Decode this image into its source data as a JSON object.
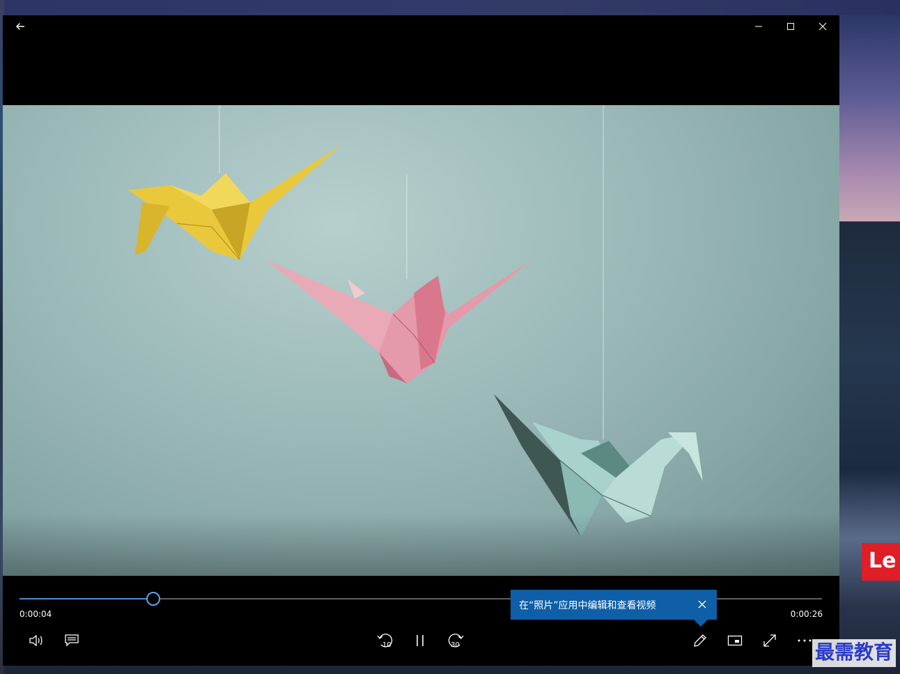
{
  "window": {
    "back_icon": "arrow-left-icon",
    "minimize_icon": "minimize-icon",
    "maximize_icon": "maximize-icon",
    "close_icon": "close-icon"
  },
  "playback": {
    "elapsed": "0:00:04",
    "total": "0:00:26",
    "progress": 0.167
  },
  "tooltip": {
    "text": "在“照片”应用中编辑和查看视频"
  },
  "controls": {
    "volume_icon": "volume-icon",
    "captions_icon": "captions-icon",
    "rewind_label": "10",
    "pause_icon": "pause-icon",
    "forward_label": "30",
    "edit_icon": "pencil-icon",
    "miniview_icon": "mini-view-icon",
    "fullscreen_icon": "fullscreen-icon",
    "more_icon": "more-icon"
  },
  "desktop": {
    "badge_text": "Le",
    "watermark": "最需教育"
  },
  "colors": {
    "accent": "#4a8fd8",
    "tooltip_bg": "#0e5fa8",
    "crane_yellow": "#e9c83b",
    "crane_pink": "#e9a9b6",
    "crane_teal": "#a9d2cc"
  }
}
